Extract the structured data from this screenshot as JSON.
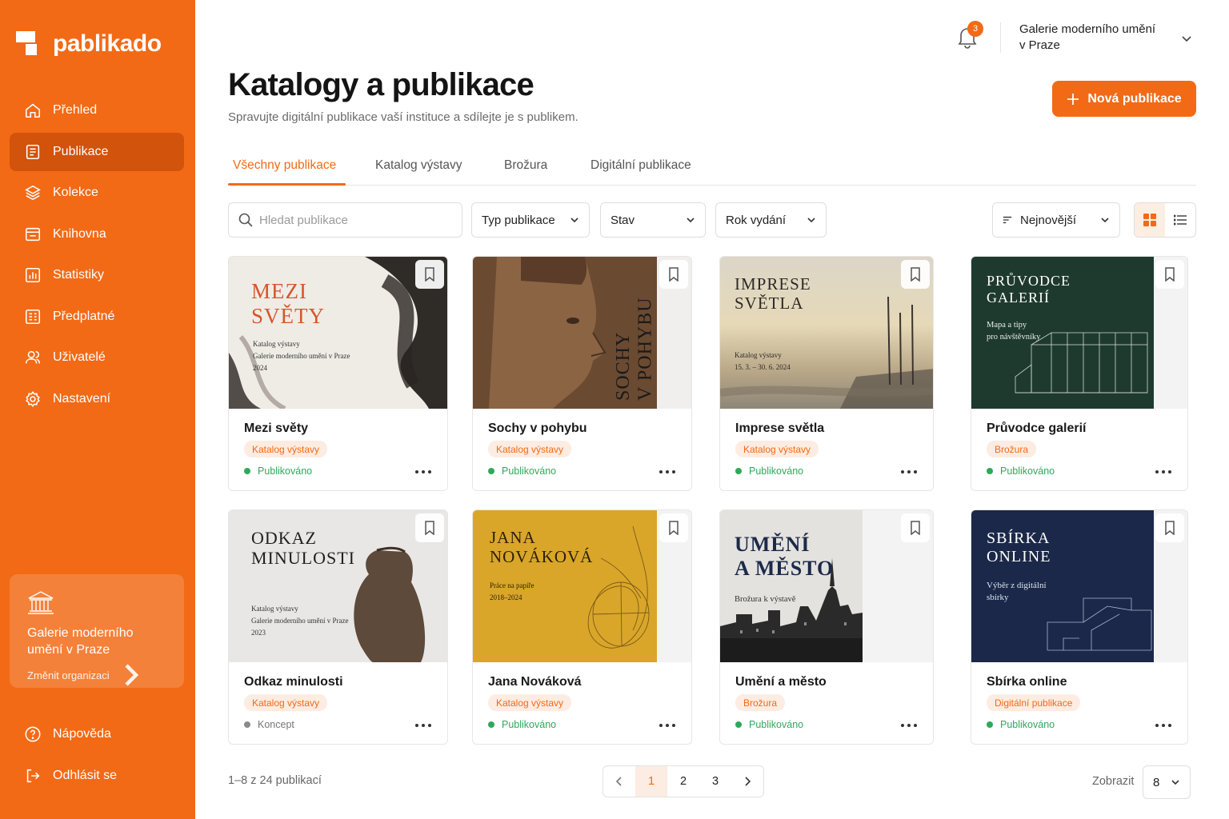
{
  "brand": {
    "name": "pablikado"
  },
  "sidebar": {
    "items": [
      {
        "label": "Přehled",
        "icon": "home-icon"
      },
      {
        "label": "Publikace",
        "icon": "document-icon",
        "active": true
      },
      {
        "label": "Kolekce",
        "icon": "layers-icon"
      },
      {
        "label": "Knihovna",
        "icon": "library-icon"
      },
      {
        "label": "Statistiky",
        "icon": "chart-icon"
      },
      {
        "label": "Předplatné",
        "icon": "subscription-icon"
      },
      {
        "label": "Uživatelé",
        "icon": "users-icon"
      },
      {
        "label": "Nastavení",
        "icon": "gear-icon"
      }
    ],
    "org": {
      "name": "Galerie moderního umění v Praze",
      "change": "Změnit organizaci"
    },
    "bottom": [
      {
        "label": "Nápověda",
        "icon": "help-icon"
      },
      {
        "label": "Odhlásit se",
        "icon": "logout-icon"
      }
    ]
  },
  "topbar": {
    "notifications": "3",
    "org_line1": "Galerie moderního umění",
    "org_line2": "v Praze"
  },
  "header": {
    "title": "Katalogy a publikace",
    "subtitle": "Spravujte digitální publikace vaší instituce a sdílejte je s publikem.",
    "new_button": "Nová publikace"
  },
  "tabs": [
    "Všechny publikace",
    "Katalog výstavy",
    "Brožura",
    "Digitální publikace"
  ],
  "filters": {
    "search_placeholder": "Hledat publikace",
    "type": "Typ publikace",
    "state": "Stav",
    "year": "Rok vydání",
    "sort": "Nejnovější"
  },
  "cards": [
    {
      "title": "Mezi světy",
      "tag": "Katalog výstavy",
      "status": "Publikováno",
      "cover": {
        "title1": "MEZI",
        "title2": "SVĚTY",
        "line1": "Katalog výstavy",
        "line2": "Galerie moderního umění v Praze",
        "line3": "2024"
      }
    },
    {
      "title": "Sochy v pohybu",
      "tag": "Katalog výstavy",
      "status": "Publikováno",
      "cover": {
        "title1": "SOCHY",
        "title2": "V POHYBU"
      }
    },
    {
      "title": "Imprese světla",
      "tag": "Katalog výstavy",
      "status": "Publikováno",
      "cover": {
        "title1": "IMPRESE",
        "title2": "SVĚTLA",
        "line1": "Katalog výstavy",
        "line2": "15. 3. – 30. 6. 2024"
      }
    },
    {
      "title": "Průvodce galerií",
      "tag": "Brožura",
      "status": "Publikováno",
      "cover": {
        "title1": "PRŮVODCE",
        "title2": "GALERIÍ",
        "line1": "Mapa a tipy",
        "line2": "pro návštěvníky"
      }
    },
    {
      "title": "Odkaz minulosti",
      "tag": "Katalog výstavy",
      "status": "Koncept",
      "cover": {
        "title1": "ODKAZ",
        "title2": "MINULOSTI",
        "line1": "Katalog výstavy",
        "line2": "Galerie moderního umění v Praze",
        "line3": "2023"
      }
    },
    {
      "title": "Jana Nováková",
      "tag": "Katalog výstavy",
      "status": "Publikováno",
      "cover": {
        "title1": "JANA",
        "title2": "NOVÁKOVÁ",
        "line1": "Práce na papíře",
        "line2": "2018–2024"
      }
    },
    {
      "title": "Umění a město",
      "tag": "Brožura",
      "status": "Publikováno",
      "cover": {
        "title1": "UMĚNÍ",
        "title2": "A MĚSTO",
        "line1": "Brožura k výstavě"
      }
    },
    {
      "title": "Sbírka online",
      "tag": "Digitální publikace",
      "status": "Publikováno",
      "cover": {
        "title1": "SBÍRKA",
        "title2": "ONLINE",
        "line1": "Výběr z digitální",
        "line2": "sbírky"
      }
    }
  ],
  "pagination": {
    "summary": "1–8 z 24 publikací",
    "pages": [
      "1",
      "2",
      "3"
    ],
    "show_label": "Zobrazit",
    "per_page": "8"
  },
  "colors": {
    "accent": "#f26a16",
    "published": "#2fa85a",
    "draft": "#8a8a8a"
  }
}
